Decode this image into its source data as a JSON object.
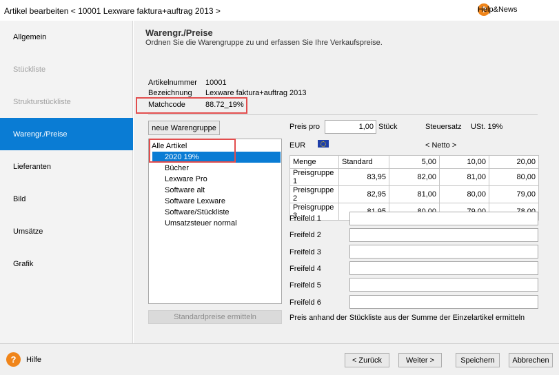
{
  "window": {
    "title": "Artikel bearbeiten < 10001 Lexware faktura+auftrag 2013 >",
    "help_label": "Help&News"
  },
  "sidebar": {
    "items": [
      {
        "label": "Allgemein",
        "state": "normal"
      },
      {
        "label": "Stückliste",
        "state": "disabled"
      },
      {
        "label": "Strukturstückliste",
        "state": "disabled"
      },
      {
        "label": "Warengr./Preise",
        "state": "active"
      },
      {
        "label": "Lieferanten",
        "state": "normal"
      },
      {
        "label": "Bild",
        "state": "normal"
      },
      {
        "label": "Umsätze",
        "state": "normal"
      },
      {
        "label": "Grafik",
        "state": "normal"
      }
    ]
  },
  "page": {
    "title": "Warengr./Preise",
    "subtitle": "Ordnen Sie die Warengruppe zu und erfassen Sie Ihre Verkaufspreise."
  },
  "article": {
    "number_label": "Artikelnummer",
    "number": "10001",
    "name_label": "Bezeichnung",
    "name": "Lexware faktura+auftrag 2013",
    "matchcode_label": "Matchcode",
    "matchcode": "88.72_19%"
  },
  "groups": {
    "new_button": "neue Warengruppe",
    "items": [
      {
        "label": "Alle Artikel",
        "level": 0,
        "selected": false
      },
      {
        "label": "2020  19%",
        "level": 1,
        "selected": true
      },
      {
        "label": "Bücher",
        "level": 1,
        "selected": false
      },
      {
        "label": "Lexware Pro",
        "level": 1,
        "selected": false
      },
      {
        "label": "Software alt",
        "level": 1,
        "selected": false
      },
      {
        "label": "Software Lexware",
        "level": 1,
        "selected": false
      },
      {
        "label": "Software/Stückliste",
        "level": 1,
        "selected": false
      },
      {
        "label": "Umsatzsteuer normal",
        "level": 1,
        "selected": false
      }
    ],
    "standard_button": "Standardpreise ermitteln"
  },
  "pricing": {
    "price_per_label": "Preis pro",
    "price_per_value": "1,00",
    "unit": "Stück",
    "tax_label": "Steuersatz",
    "tax_value": "USt. 19%",
    "currency": "EUR",
    "netto": "< Netto >",
    "table": {
      "headers": [
        "Menge",
        "Standard",
        "5,00",
        "10,00",
        "20,00"
      ],
      "rows": [
        [
          "Preisgruppe 1",
          "83,95",
          "82,00",
          "81,00",
          "80,00"
        ],
        [
          "Preisgruppe 2",
          "82,95",
          "81,00",
          "80,00",
          "79,00"
        ],
        [
          "Preisgruppe 3",
          "81,95",
          "80,00",
          "79,00",
          "78,00"
        ]
      ]
    }
  },
  "freefields": {
    "labels": [
      "Freifeld 1",
      "Freifeld 2",
      "Freifeld 3",
      "Freifeld 4",
      "Freifeld 5",
      "Freifeld 6"
    ],
    "values": [
      "",
      "",
      "",
      "",
      "",
      ""
    ]
  },
  "bom_note": "Preis anhand der Stückliste aus der Summe der Einzelartikel ermitteln",
  "footer": {
    "help_label": "Hilfe",
    "back": "< Zurück",
    "next": "Weiter >",
    "save": "Speichern",
    "cancel": "Abbrechen"
  },
  "colors": {
    "accent": "#0a7cd4",
    "highlight": "#e24d4d",
    "help": "#f0851a"
  }
}
